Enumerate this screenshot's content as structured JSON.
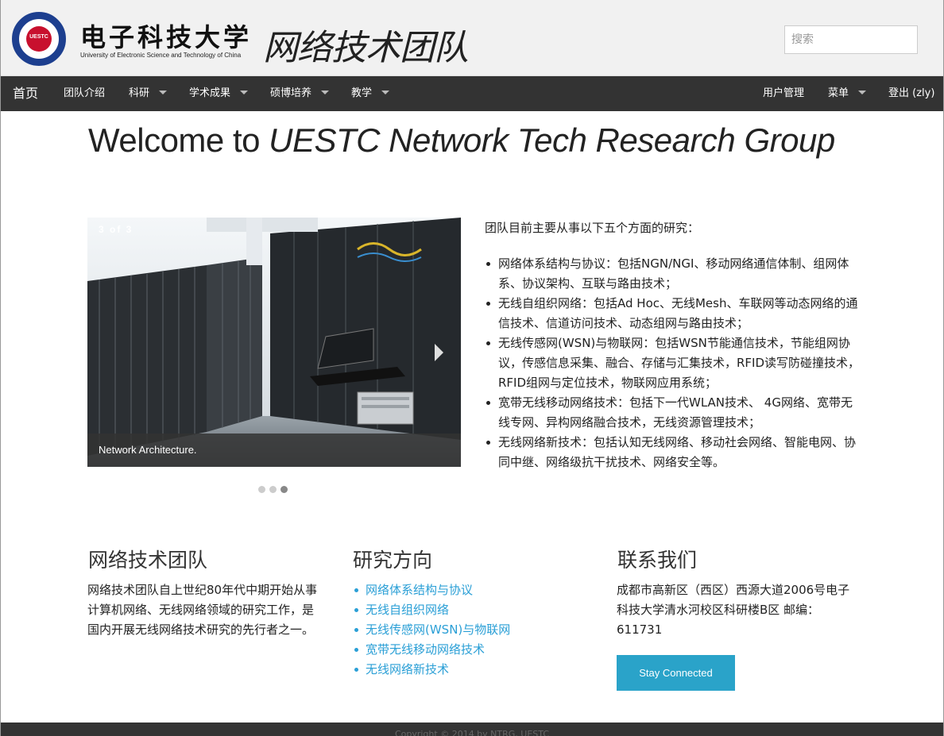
{
  "header": {
    "logo_cn": "电子科技大学",
    "logo_en": "University of Electronic Science and Technology of China",
    "logo_seal_text": "UESTC",
    "group_name": "网络技术团队",
    "search_placeholder": "搜索"
  },
  "nav": {
    "home": "首页",
    "items": [
      {
        "label": "团队介绍"
      },
      {
        "label": "科研"
      },
      {
        "label": "学术成果"
      },
      {
        "label": "硕博培养"
      },
      {
        "label": "教学"
      }
    ],
    "right": [
      {
        "label": "用户管理"
      },
      {
        "label": "菜单"
      },
      {
        "label": "登出 (zly)"
      }
    ]
  },
  "main": {
    "welcome_plain": "Welcome to ",
    "welcome_em": "UESTC Network Tech Research Group",
    "slider": {
      "counter": "3 of 3",
      "caption": "Network Architecture.",
      "slides_total": 3,
      "active_index": 3
    },
    "intro": "团队目前主要从事以下五个方面的研究：",
    "research": [
      "网络体系结构与协议：包括NGN/NGI、移动网络通信体制、组网体系、协议架构、互联与路由技术；",
      "无线自组织网络：包括Ad Hoc、无线Mesh、车联网等动态网络的通信技术、信道访问技术、动态组网与路由技术；",
      "无线传感网(WSN)与物联网：包括WSN节能通信技术，节能组网协议，传感信息采集、融合、存储与汇集技术，RFID读写防碰撞技术，RFID组网与定位技术，物联网应用系统；",
      "宽带无线移动网络技术：包括下一代WLAN技术、 4G网络、宽带无线专网、异构网络融合技术，无线资源管理技术；",
      "无线网络新技术：包括认知无线网络、移动社会网络、智能电网、协同中继、网络级抗干扰技术、网络安全等。"
    ]
  },
  "columns": {
    "team": {
      "title": "网络技术团队",
      "text": "网络技术团队自上世纪80年代中期开始从事计算机网络、无线网络领域的研究工作，是国内开展无线网络技术研究的先行者之一。"
    },
    "directions": {
      "title": "研究方向",
      "links": [
        "网络体系结构与协议",
        "无线自组织网络",
        "无线传感网(WSN)与物联网",
        "宽带无线移动网络技术",
        "无线网络新技术"
      ]
    },
    "contact": {
      "title": "联系我们",
      "text": "成都市高新区（西区）西源大道2006号电子科技大学清水河校区科研楼B区 邮编：611731",
      "button": "Stay Connected"
    }
  },
  "footer": {
    "text": "Copyright © 2014 by NTRG, UESTC"
  },
  "colors": {
    "nav_bg": "#333333",
    "header_bg": "#f1f1f1",
    "link": "#2a9fd6",
    "button": "#2aa3c9"
  }
}
